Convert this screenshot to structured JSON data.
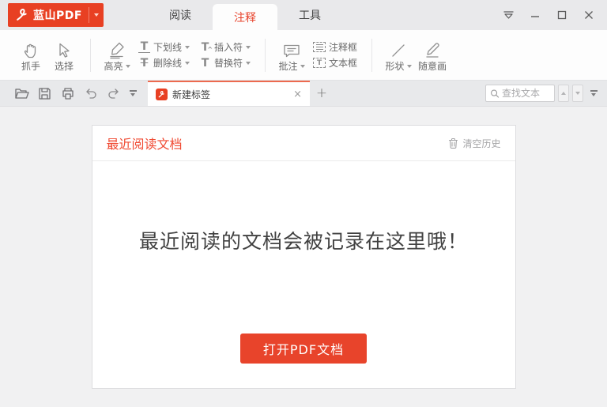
{
  "colors": {
    "accent_red": "#e8432c",
    "logo_red": "#e84023",
    "panel_title_red": "#f04a32",
    "button_red": "#e8442b",
    "tab_top_border": "#ed6a4f",
    "titlebar_bg": "#e9e9eb",
    "content_bg": "#f1f1f2"
  },
  "titlebar": {
    "logo_label": "蓝山PDF",
    "tabs": [
      {
        "label": "阅读"
      },
      {
        "label": "注释"
      },
      {
        "label": "工具"
      }
    ]
  },
  "ribbon": {
    "hand": "抓手",
    "select": "选择",
    "highlight": "高亮",
    "underline": "下划线",
    "strikethrough": "删除线",
    "caret_insert": "插入符",
    "replace": "替换符",
    "comment": "批注",
    "note_box": "注释框",
    "text_box": "文本框",
    "shape": "形状",
    "freedraw": "随意画"
  },
  "tabbar": {
    "doc_tab_label": "新建标签",
    "search_placeholder": "查找文本"
  },
  "panel": {
    "title": "最近阅读文档",
    "clear_history": "清空历史",
    "empty_message": "最近阅读的文档会被记录在这里哦！",
    "open_button": "打开PDF文档"
  },
  "icons": {
    "t_glyph": "T",
    "close_glyph": "×",
    "plus_glyph": "+"
  }
}
